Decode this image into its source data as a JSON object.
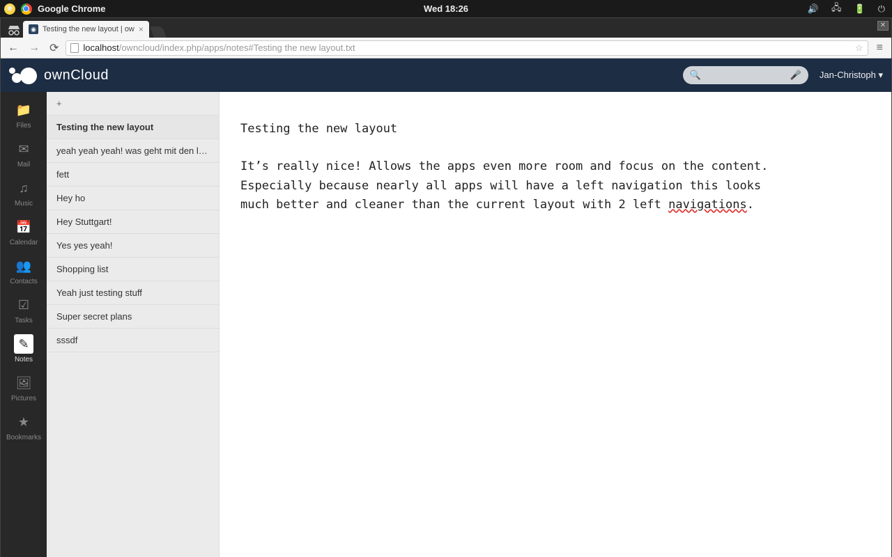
{
  "panel": {
    "app": "Google Chrome",
    "clock": "Wed 18:26"
  },
  "browser": {
    "tab_title": "Testing the new layout | ow",
    "url_host": "localhost",
    "url_path": "/owncloud/index.php/apps/notes#Testing the new layout.txt"
  },
  "header": {
    "logo_text": "ownCloud",
    "user": "Jan-Christoph ▾"
  },
  "apps": [
    {
      "label": "Files"
    },
    {
      "label": "Mail"
    },
    {
      "label": "Music"
    },
    {
      "label": "Calendar"
    },
    {
      "label": "Contacts"
    },
    {
      "label": "Tasks"
    },
    {
      "label": "Notes"
    },
    {
      "label": "Pictures"
    },
    {
      "label": "Bookmarks"
    }
  ],
  "sidebar": {
    "new": "+",
    "items": [
      "Testing the new layout",
      "yeah yeah yeah! was geht mit den l…",
      "fett",
      "Hey ho",
      "Hey Stuttgart!",
      "Yes yes yeah!",
      "Shopping list",
      "Yeah just testing stuff",
      "Super secret plans",
      "sssdf"
    ]
  },
  "note": {
    "title": "Testing the new layout",
    "body1": "It’s really nice! Allows the apps even more room and focus on the content. Especially because nearly all apps will have a left navigation this looks much better and cleaner than the current layout with 2 left ",
    "word_misspelled": "navigations",
    "body2": "."
  }
}
